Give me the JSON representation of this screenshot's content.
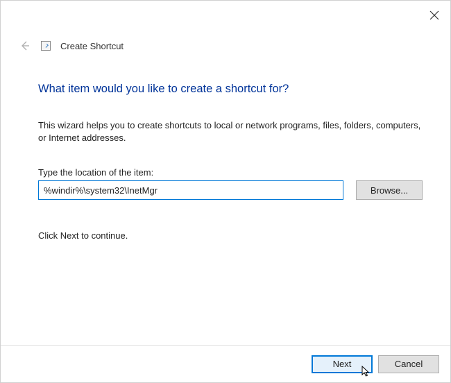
{
  "wizard": {
    "title": "Create Shortcut",
    "heading": "What item would you like to create a shortcut for?",
    "description": "This wizard helps you to create shortcuts to local or network programs, files, folders, computers, or Internet addresses.",
    "input_label": "Type the location of the item:",
    "input_value": "%windir%\\system32\\InetMgr",
    "browse_label": "Browse...",
    "continue_text": "Click Next to continue."
  },
  "footer": {
    "next_label": "Next",
    "cancel_label": "Cancel"
  }
}
